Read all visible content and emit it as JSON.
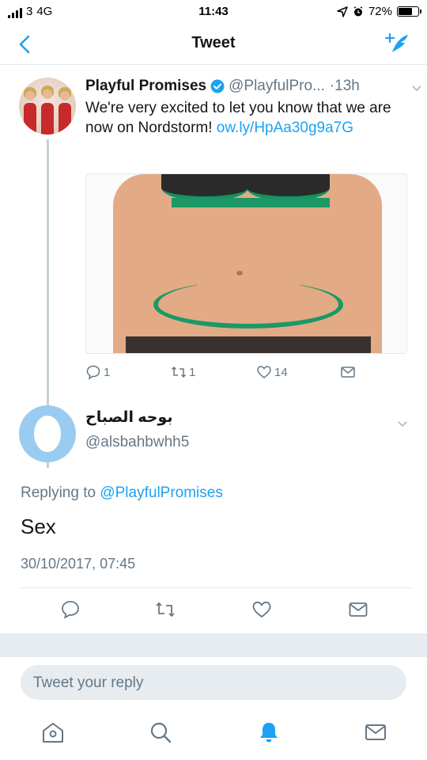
{
  "status_bar": {
    "carrier": "3",
    "network": "4G",
    "time": "11:43",
    "battery": "72%",
    "battery_level": 0.72
  },
  "nav": {
    "title": "Tweet"
  },
  "tweet": {
    "name": "Playful Promises",
    "handle": "@PlayfulPro...",
    "time": "·13h",
    "text": "We're very excited to let you know that we are now on Nordstorm! ",
    "link": "ow.ly/HpAa30g9a7G",
    "reply_count": "1",
    "retweet_count": "1",
    "like_count": "14"
  },
  "reply": {
    "name": "بوحه الصباح",
    "handle": "@alsbahbwhh5",
    "replying_prefix": "Replying to ",
    "replying_to": "@PlayfulPromises",
    "text": "Sex",
    "date": "30/10/2017, 07:45"
  },
  "reply_box": {
    "placeholder": "Tweet your reply"
  },
  "colors": {
    "accent": "#1da1f2",
    "muted": "#657786"
  },
  "icons": [
    "back-icon",
    "compose-tweet-icon",
    "verified-icon",
    "reply-icon",
    "retweet-icon",
    "like-icon",
    "direct-message-icon",
    "home-icon",
    "search-icon",
    "notifications-icon",
    "messages-icon"
  ]
}
